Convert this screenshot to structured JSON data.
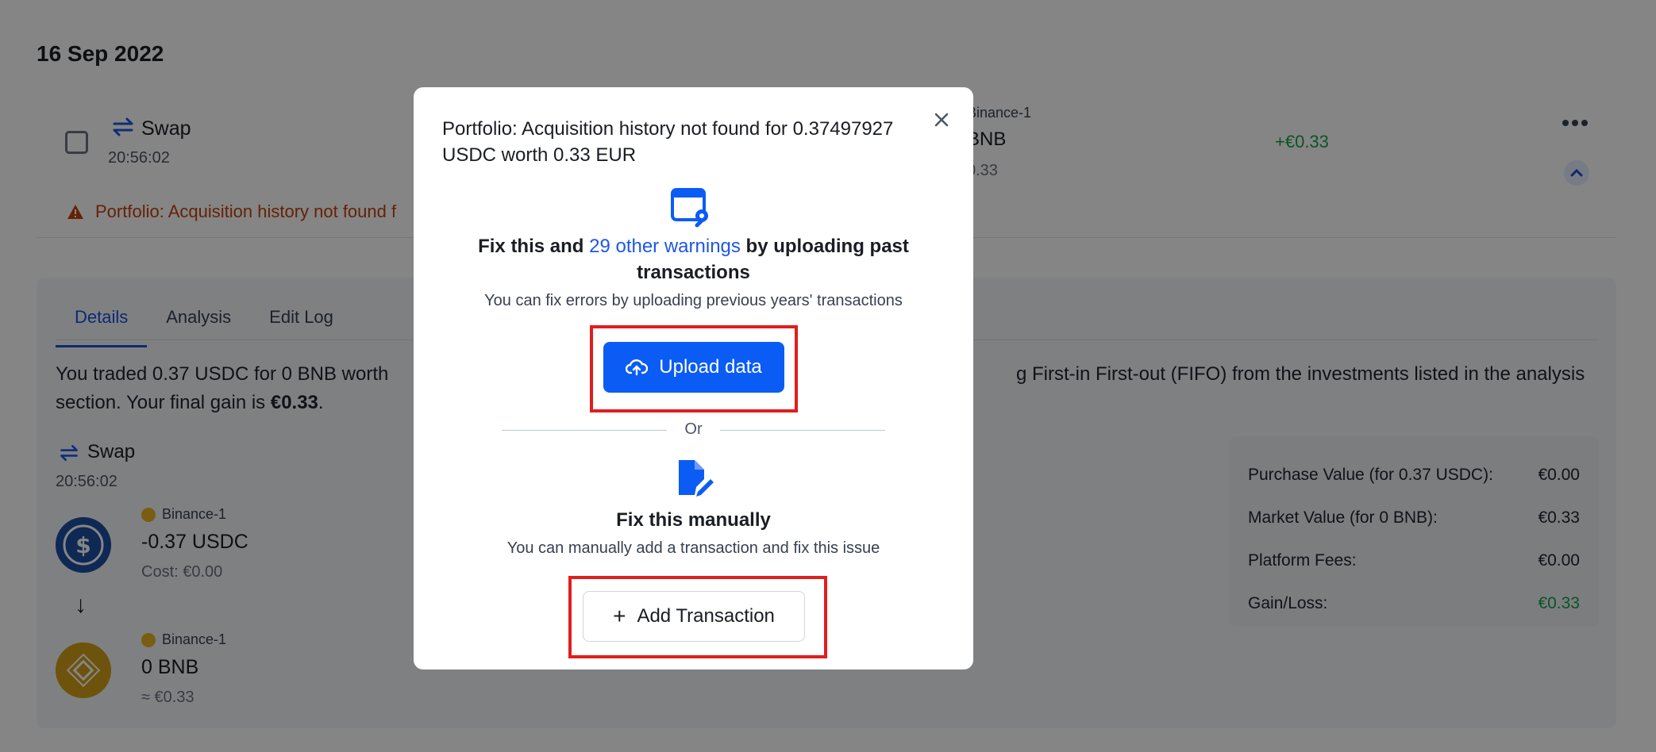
{
  "background": {
    "date_heading": "16 Sep 2022",
    "transaction": {
      "type": "Swap",
      "time": "20:56:02",
      "right_platform": "Binance-1",
      "right_amount": "BNB",
      "right_value": "0.33",
      "gain": "+€0.33"
    },
    "warning_text": "Portfolio: Acquisition history not found f",
    "tabs": [
      {
        "label": "Details",
        "active": true
      },
      {
        "label": "Analysis",
        "active": false
      },
      {
        "label": "Edit Log",
        "active": false
      }
    ],
    "summary": {
      "line1_left": "You traded 0.37 USDC for 0 BNB worth",
      "line1_right": "g First-in First-out (FIFO) from the investments listed in the analysis",
      "line2_prefix": "section. Your final gain is ",
      "line2_gain": "€0.33",
      "line2_suffix": "."
    },
    "swap_detail": {
      "label": "Swap",
      "time": "20:56:02"
    },
    "assets": [
      {
        "platform": "Binance-1",
        "amount": "-0.37 USDC",
        "sub": "Cost: €0.00",
        "icon": "usdc-coin-icon"
      },
      {
        "platform": "Binance-1",
        "amount": "0 BNB",
        "sub": "≈ €0.33",
        "icon": "bnb-coin-icon"
      }
    ],
    "arrow": "↓",
    "value_card": [
      {
        "label": "Purchase Value (for 0.37 USDC):",
        "value": "€0.00",
        "green": false
      },
      {
        "label": "Market Value (for 0 BNB):",
        "value": "€0.33",
        "green": false
      },
      {
        "label": "Platform Fees:",
        "value": "€0.00",
        "green": false
      },
      {
        "label": "Gain/Loss:",
        "value": "€0.33",
        "green": true
      }
    ]
  },
  "modal": {
    "title": "Portfolio: Acquisition history not found for 0.37497927 USDC worth 0.33 EUR",
    "fix_heading_prefix": "Fix this and ",
    "fix_heading_link": "29 other warnings",
    "fix_heading_suffix": " by uploading past transactions",
    "fix_sub": "You can fix errors by uploading previous years' transactions",
    "upload_button": "Upload data",
    "or_text": "Or",
    "manual_heading": "Fix this manually",
    "manual_sub": "You can manually add a transaction and fix this issue",
    "add_button": "Add Transaction",
    "add_button_icon": "+"
  },
  "colors": {
    "primary": "#0b5cf5",
    "link": "#1d57e6",
    "warning": "#c2410c",
    "gain": "#16a34a",
    "highlight": "#e11d1d"
  }
}
